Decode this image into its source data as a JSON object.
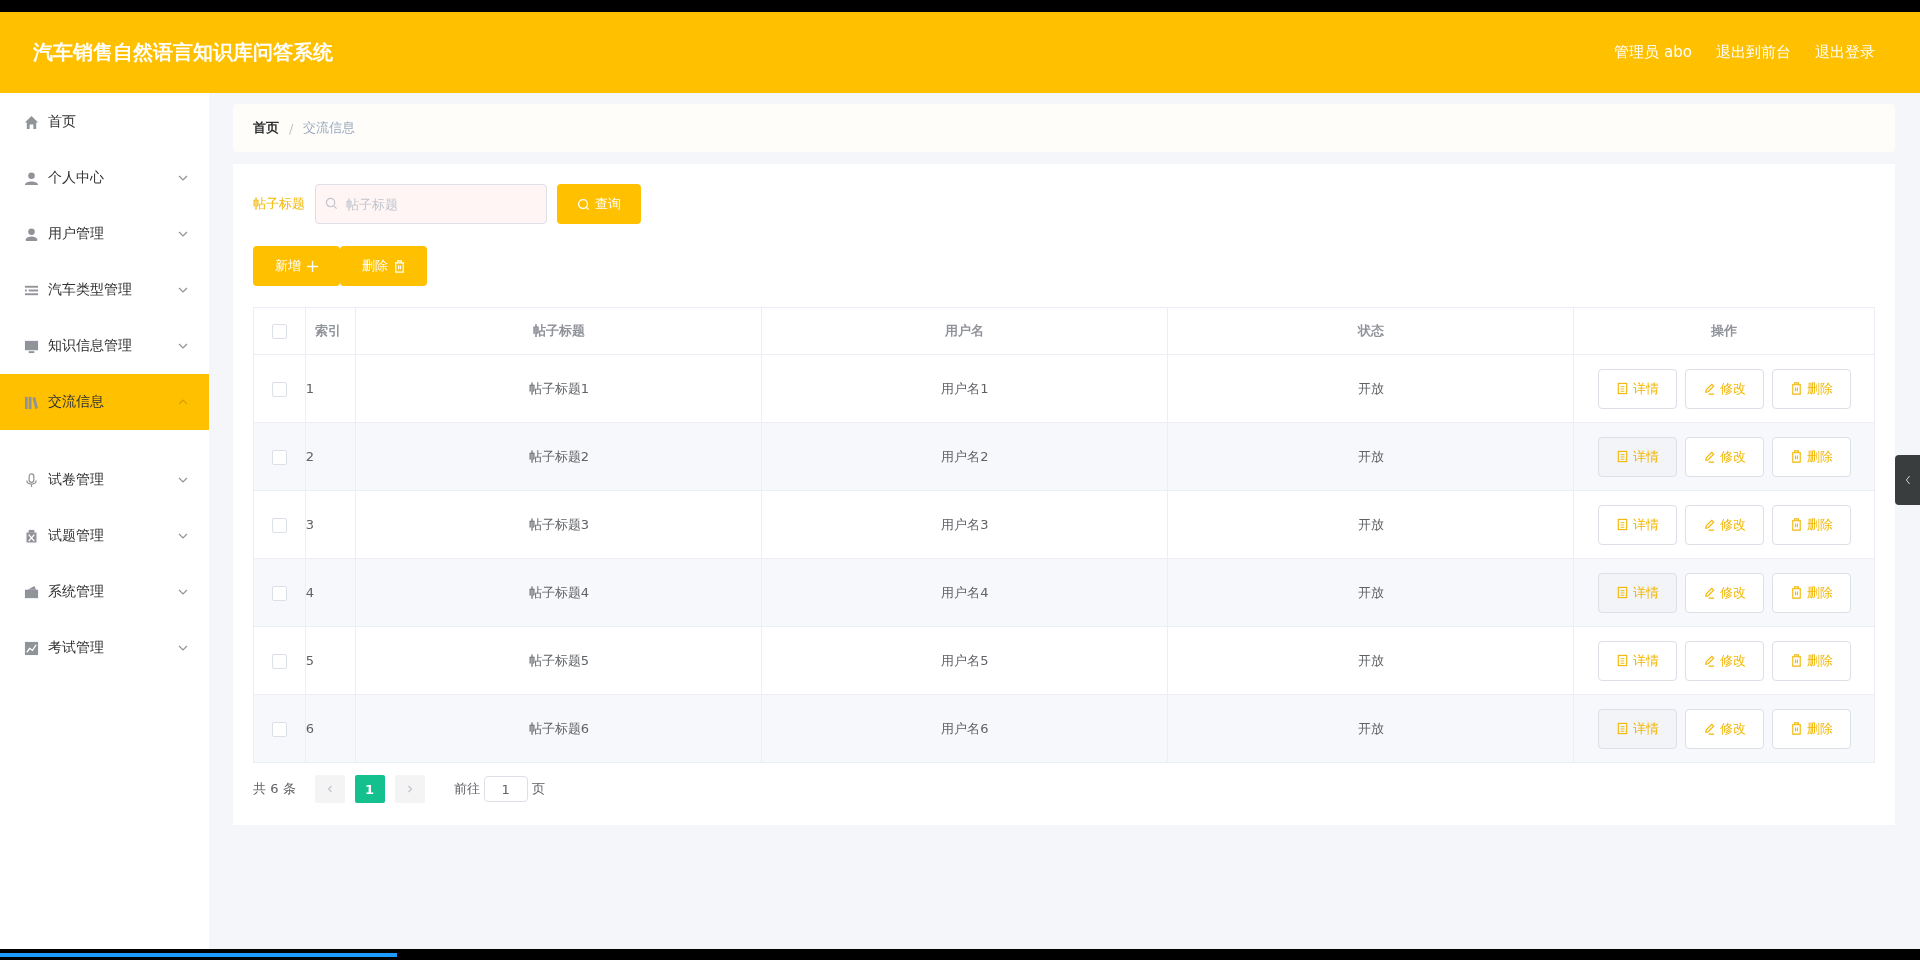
{
  "header": {
    "title": "汽车销售自然语言知识库问答系统",
    "links": [
      "管理员 abo",
      "退出到前台",
      "退出登录"
    ]
  },
  "sidebar": {
    "items": [
      {
        "label": "首页",
        "selected": false
      },
      {
        "label": "个人中心",
        "selected": false,
        "expanded": false
      },
      {
        "label": "用户管理",
        "selected": false,
        "expanded": false
      },
      {
        "label": "汽车类型管理",
        "selected": false,
        "expanded": false
      },
      {
        "label": "知识信息管理",
        "selected": false,
        "expanded": false
      },
      {
        "label": "交流信息",
        "selected": true,
        "expanded": true
      },
      {
        "label": "试卷管理",
        "selected": false,
        "expanded": false
      },
      {
        "label": "试题管理",
        "selected": false,
        "expanded": false
      },
      {
        "label": "系统管理",
        "selected": false,
        "expanded": false
      },
      {
        "label": "考试管理",
        "selected": false,
        "expanded": false
      }
    ]
  },
  "breadcrumb": {
    "items": [
      "首页",
      "交流信息"
    ],
    "separator": "/"
  },
  "search": {
    "label": "帖子标题",
    "placeholder": "帖子标题",
    "button": "查询"
  },
  "actions": [
    "新增",
    "删除"
  ],
  "table": {
    "columns": [
      "索引",
      "帖子标题",
      "用户名",
      "状态",
      "操作"
    ],
    "all_checked": false,
    "rows": [
      {
        "index": "1",
        "title": "帖子标题1",
        "user": "用户名1",
        "status": "开放",
        "checked": false,
        "buttons": [
          "详情",
          "修改",
          "删除"
        ]
      },
      {
        "index": "2",
        "title": "帖子标题2",
        "user": "用户名2",
        "status": "开放",
        "checked": false,
        "buttons": [
          "详情",
          "修改",
          "删除"
        ]
      },
      {
        "index": "3",
        "title": "帖子标题3",
        "user": "用户名3",
        "status": "开放",
        "checked": false,
        "buttons": [
          "详情",
          "修改",
          "删除"
        ]
      },
      {
        "index": "4",
        "title": "帖子标题4",
        "user": "用户名4",
        "status": "开放",
        "checked": false,
        "buttons": [
          "详情",
          "修改",
          "删除"
        ]
      },
      {
        "index": "5",
        "title": "帖子标题5",
        "user": "用户名5",
        "status": "开放",
        "checked": false,
        "buttons": [
          "详情",
          "修改",
          "删除"
        ]
      },
      {
        "index": "6",
        "title": "帖子标题6",
        "user": "用户名6",
        "status": "开放",
        "checked": false,
        "buttons": [
          "详情",
          "修改",
          "删除"
        ]
      }
    ]
  },
  "pagination": {
    "total": "共 6 条",
    "pages": [
      {
        "label": "1",
        "selected": true
      }
    ],
    "goto_label": "前往",
    "goto_value": "1",
    "page_suffix": "页"
  },
  "player": {
    "level": 0.207
  }
}
